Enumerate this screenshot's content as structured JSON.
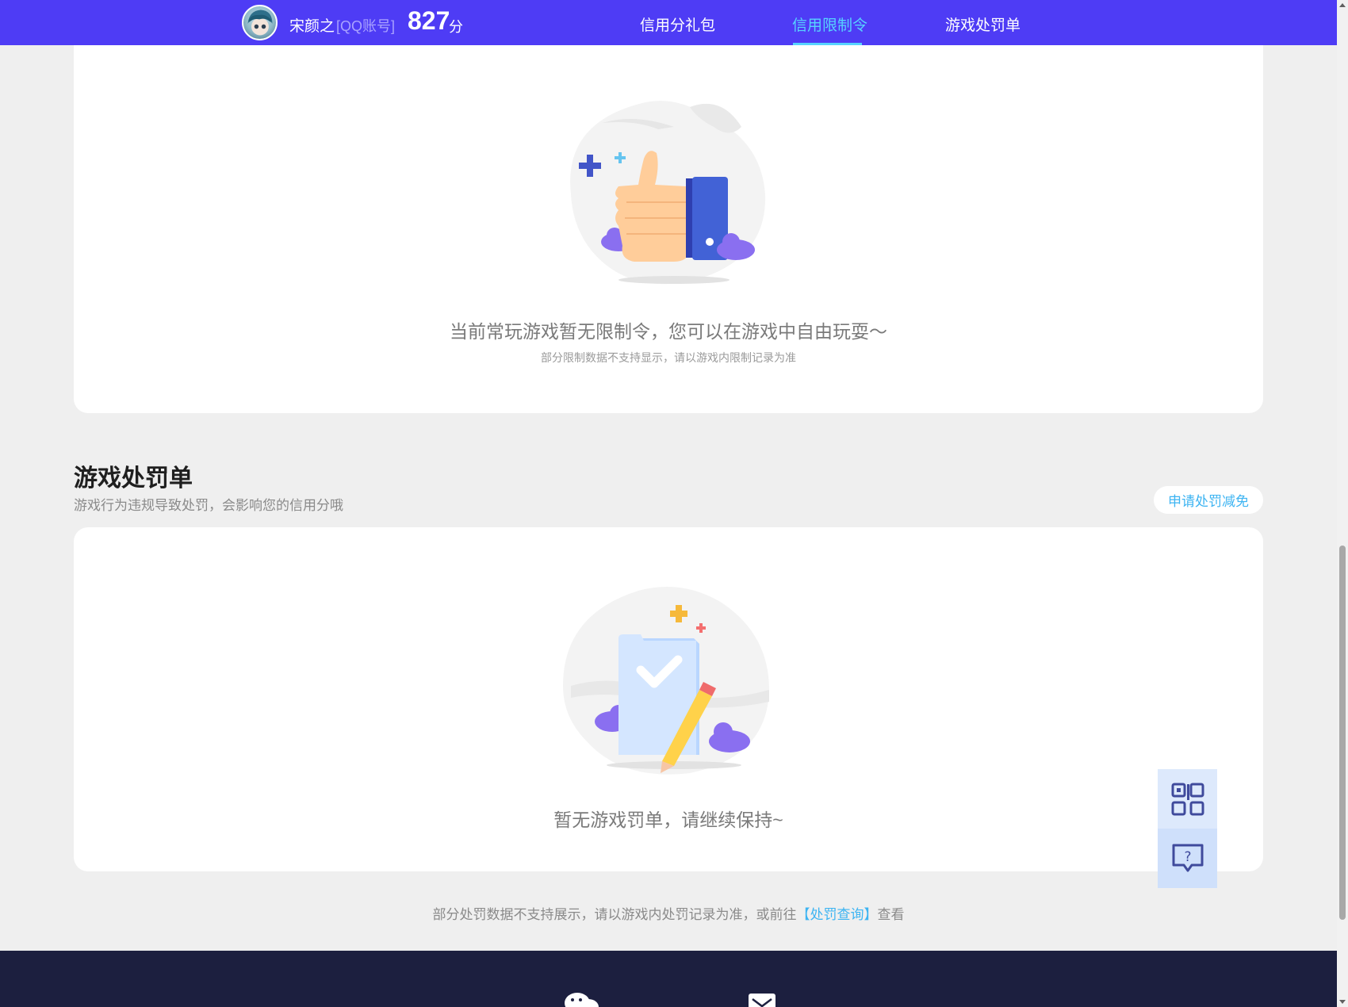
{
  "header": {
    "user_name": "宋颜之",
    "account_tag": "[QQ账号]",
    "score": "827",
    "score_unit": "分",
    "nav": [
      {
        "label": "信用分礼包",
        "active": false
      },
      {
        "label": "信用限制令",
        "active": true
      },
      {
        "label": "游戏处罚单",
        "active": false
      }
    ]
  },
  "restriction_card": {
    "empty_message": "当前常玩游戏暂无限制令，您可以在游戏中自由玩耍～",
    "empty_sub": "部分限制数据不支持显示，请以游戏内限制记录为准"
  },
  "penalty_section": {
    "title": "游戏处罚单",
    "subtitle": "游戏行为违规导致处罚，会影响您的信用分哦",
    "appeal_button": "申请处罚减免",
    "empty_message": "暂无游戏罚单，请继续保持~"
  },
  "footer_note": {
    "prefix": "部分处罚数据不支持展示，请以游戏内处罚记录为准，或前往",
    "link": "【处罚查询】",
    "suffix": "查看"
  },
  "side_float": {
    "qr_icon": "qr-code-icon",
    "help_icon": "help-chat-icon"
  },
  "colors": {
    "header_bg": "#4e3cf5",
    "active_nav": "#57d3ff",
    "link": "#3db4f2",
    "footer_bg": "#1c1f3f"
  }
}
